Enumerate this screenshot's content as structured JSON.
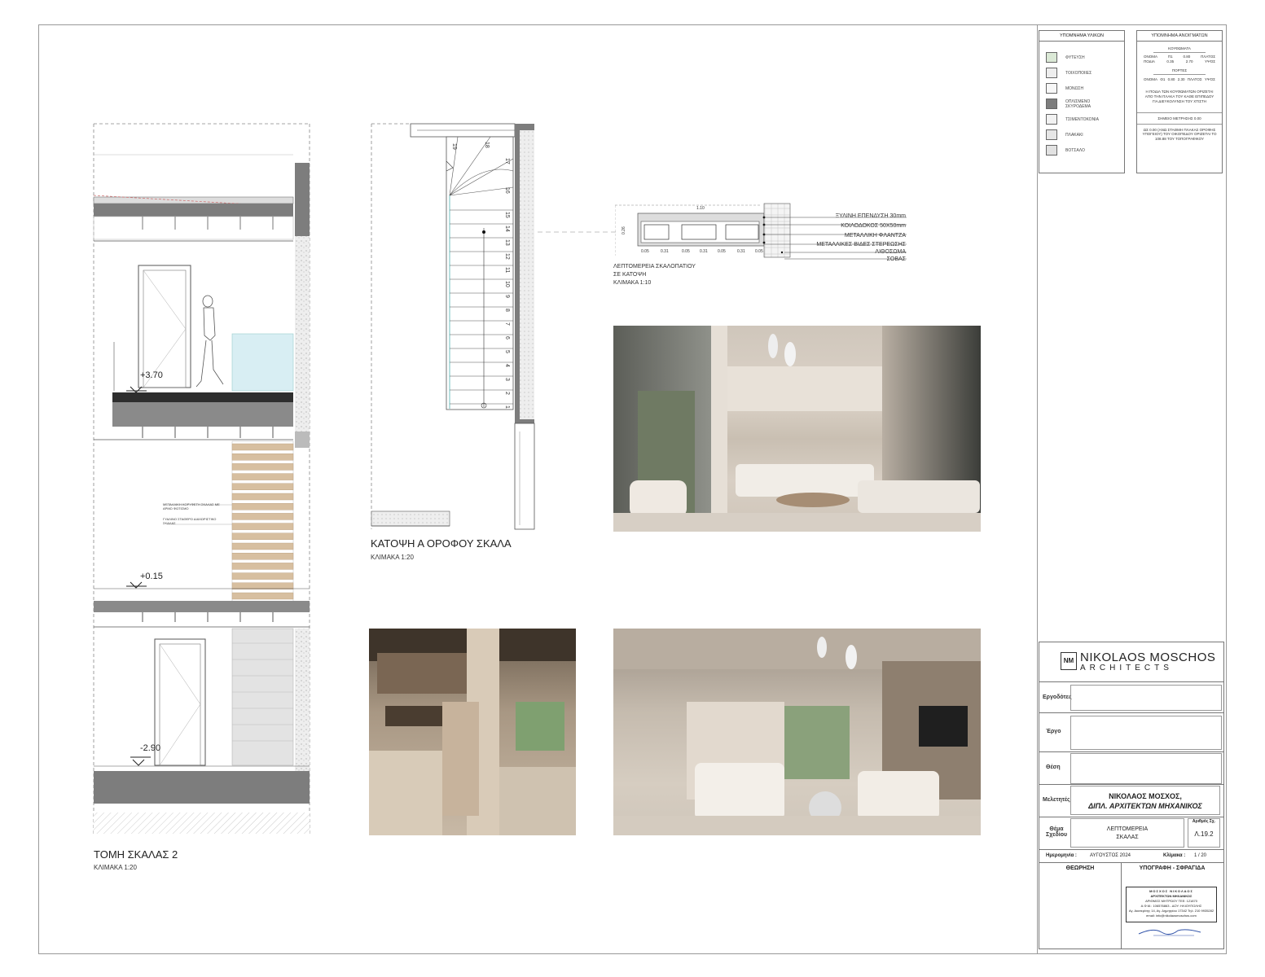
{
  "section_drawing": {
    "title": "ΤΟΜΗ ΣΚΑΛΑΣ 2",
    "scale": "ΚΛΙΜΑΚΑ 1:20",
    "levels": [
      "+3.70",
      "+0.15",
      "-2.90"
    ],
    "annotations": [
      "ΜΕΤΑΛΛΙΚΗ ΚΟΡΥΦΕΤΗ ΣΚΑΛΑΣ ΜΕ ΑΡΜΟ ΦΩΤΙΣΜΟ",
      "ΓΥΑΛΙΝΟ ΣΤΑΘΕΡΟ ΔΙΑΧΩΡΙΣΤΙΚΟ ΣΚΑΛΑΣ"
    ]
  },
  "plan_drawing": {
    "title": "ΚΑΤΟΨΗ Α ΟΡΟΦΟΥ ΣΚΑΛΑ",
    "scale": "ΚΛΙΜΑΚΑ 1:20",
    "step_numbers": [
      "19",
      "18",
      "17",
      "16",
      "15",
      "14",
      "13",
      "12",
      "11",
      "10",
      "9",
      "8",
      "7",
      "6",
      "5",
      "4",
      "3",
      "2",
      "1"
    ]
  },
  "step_detail": {
    "title_line1": "ΛΕΠΤΟΜΕΡΕΙΑ ΣΚΑΛΟΠΑΤΙΟΥ",
    "title_line2": "ΣΕ ΚΑΤΟΨΗ",
    "scale": "ΚΛΙΜΑΚΑ 1:10",
    "top_dimension": "1.10",
    "side_dimension": "0.26",
    "bottom_dimensions": [
      "0.05",
      "0.31",
      "0.05",
      "0.31",
      "0.05",
      "0.31",
      "0.05"
    ],
    "layers": [
      "ΞΥΛΙΝΗ ΕΠΕΝΔΥΣΗ 30mm",
      "ΚΟΙΛΟΔΟΚΟΣ 50Χ50mm",
      "ΜΕΤΑΛΛΙΚΗ ΦΛΑΝΤΖΑ",
      "ΜΕΤΑΛΛΙΚΕΣ ΒΙΔΕΣ ΣΤΕΡΕΩΣΗΣ",
      "ΛΙΘΟΣΩΜΑ",
      "ΣΟΒΑΣ"
    ]
  },
  "materials_legend": {
    "title": "ΥΠΟΜΝΗΜΑ ΥΛΙΚΩΝ",
    "items": [
      {
        "label": "ΦΥΤΕΥΣΗ",
        "color": "#dbe9d6"
      },
      {
        "label": "ΤΟΙΧΟΠΟΙΙΕΣ",
        "color": "#eeeeee"
      },
      {
        "label": "ΜΟΝΩΣΗ",
        "color": "#f7f7f7"
      },
      {
        "label": "ΟΠΛΙΣΜΕΝΟ ΣΚΥΡΟΔΕΜΑ",
        "color": "#7d7d7d"
      },
      {
        "label": "ΤΣΙΜΕΝΤΟΚΟΝΙΑ",
        "color": "#f2f2f2"
      },
      {
        "label": "ΠΛΑΚΑΚΙ",
        "color": "#e6e6e6"
      },
      {
        "label": "ΒΟΤΣΑΛΟ",
        "color": "#e2e2e2"
      }
    ]
  },
  "openings_legend": {
    "title": "ΥΠΟΜΝΗΜΑ ΑΝΟΙΓΜΑΤΩΝ",
    "windows_title": "ΚΟΥΦΩΜΑΤΑ",
    "windows_row1": [
      "ΟΝΟΜΑ",
      "Π1",
      "0.80",
      "ΠΛΑΤΟΣ"
    ],
    "windows_row2": [
      "ΠΟΔΙΑ",
      "0.35",
      "2.70",
      "ΥΨΟΣ"
    ],
    "doors_title": "ΠΟΡΤΕΣ",
    "doors_row": [
      "ΟΝΟΜΑ",
      "Θ1",
      "0.80",
      "2.30",
      "ΠΛΑΤΟΣ",
      "ΥΨΟΣ"
    ],
    "note": "Η ΠΟΔΙΑ ΤΩΝ ΚΟΥΦΩΜΑΤΩΝ ΟΡΙΖΕΤΑΙ ΑΠΟ ΤΗΝ ΠΛΑΚΑ ΤΟΥ ΚΑΘΕ ΕΠΙΠΕΔΟΥ ΓΙΑ ΔΙΕΥΚΟΛΥΝΣΗ ΤΟΥ ΧΤΙΣΤΗ",
    "measure_title": "ΣΗΜΕΙΟ ΜΕΤΡΗΣΗΣ 0.00",
    "measure_note": "ΩΣ 0.00 (ΑΝΩ ΣΤΑΘΜΗ ΠΛΑΚΑΣ ΟΡΟΦΗΣ ΥΠΟΓΕΙΟΥ) ΤΟΥ ΟΙΚΟΠΕΔΟΥ ΟΡΙΖΕΤΑΙ ΤΟ 108.88 ΤΟΥ ΤΟΠΟΓΡΑΦΙΚΟΥ"
  },
  "title_block": {
    "logo_text": "NM",
    "company_name": "NIKOLAOS MOSCHOS",
    "company_sub": "ARCHITECTS",
    "labels": {
      "clients": "Εργοδότες",
      "project": "Έργο",
      "location": "Θέση",
      "designers": "Μελετητές",
      "subject": "Θέμα Σχεδίου",
      "drawing_no": "Αριθμός Σχ.",
      "date": "Ημερομηνία :",
      "scale": "Κλίμακα :",
      "review": "ΘΕΩΡΗΣΗ",
      "signature": "ΥΠΟΓΡΑΦΗ - ΣΦΡΑΓΙΔΑ"
    },
    "clients": "",
    "project": "",
    "location": "",
    "designer_line1": "ΝΙΚΟΛΑΟΣ ΜΟΣΧΟΣ,",
    "designer_line2": "ΔΙΠΛ. ΑΡΧΙΤΕΚΤΩΝ ΜΗΧΑΝΙΚΟΣ",
    "subject_line1": "ΛΕΠΤΟΜΕΡΕΙΑ",
    "subject_line2": "ΣΚΑΛΑΣ",
    "drawing_no": "Λ.19.2",
    "date": "ΑΥΓΟΥΣΤΟΣ 2024",
    "scale": "1 / 20",
    "stamp_lines": [
      "ΜΟΣΧΟΣ ΝΙΚΟΛΑΟΣ",
      "ΑΡΧΙΤΕΚΤΩΝ ΜΗΧΑΝΙΚΟΣ",
      "ΑΡΙΘΜΟΣ ΜΗΤΡΩΟΥ ΤΕΕ: 121870",
      "Α.Φ.Μ.: 106576863 - ΔΟΥ: ΗΛΙΟΥΠΟΛΗΣ",
      "Αγ. Ακατερίνης 14, Αγ. Δημητρίου 17342 Τηλ: 210 9935282",
      "email: info@nikolaosmoschos.com"
    ]
  }
}
